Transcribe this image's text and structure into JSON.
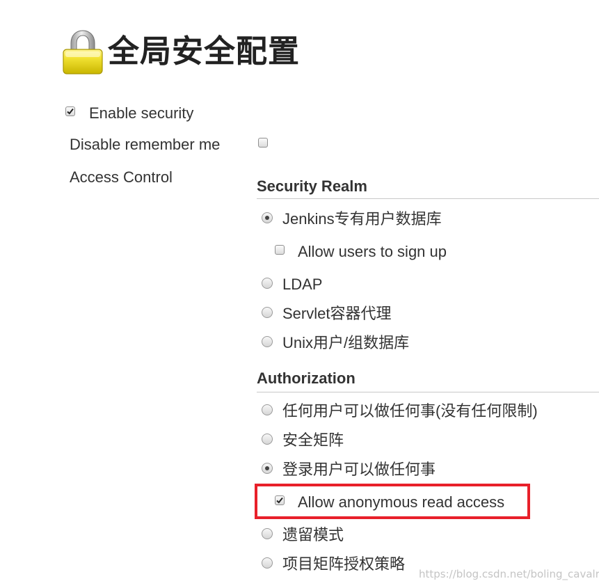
{
  "header": {
    "title": "全局安全配置",
    "icon": "lock-icon"
  },
  "settings": {
    "enable_security": {
      "label": "Enable security",
      "checked": true
    },
    "disable_remember_me": {
      "label": "Disable remember me",
      "checked": false
    },
    "access_control_label": "Access Control"
  },
  "security_realm": {
    "title": "Security Realm",
    "options": [
      {
        "label": "Jenkins专有用户数据库",
        "selected": true
      },
      {
        "label": "LDAP",
        "selected": false
      },
      {
        "label": "Servlet容器代理",
        "selected": false
      },
      {
        "label": "Unix用户/组数据库",
        "selected": false
      }
    ],
    "allow_signup": {
      "label": "Allow users to sign up",
      "checked": false
    }
  },
  "authorization": {
    "title": "Authorization",
    "options": [
      {
        "label": "任何用户可以做任何事(没有任何限制)",
        "selected": false
      },
      {
        "label": "安全矩阵",
        "selected": false
      },
      {
        "label": "登录用户可以做任何事",
        "selected": true
      },
      {
        "label": "遗留模式",
        "selected": false
      },
      {
        "label": "项目矩阵授权策略",
        "selected": false
      }
    ],
    "allow_anonymous_read": {
      "label": "Allow anonymous read access",
      "checked": true
    }
  },
  "colors": {
    "highlight_border": "#e8202a",
    "lock_gold": "#e8d400",
    "text": "#333333"
  },
  "watermark": "https://blog.csdn.net/boling_cavalry"
}
